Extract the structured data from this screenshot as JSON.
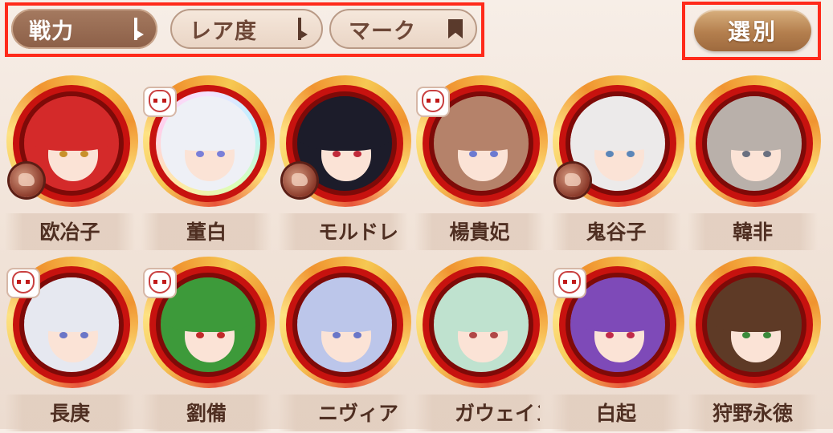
{
  "toolbar": {
    "sort_power": "戦力",
    "sort_rarity": "レア度",
    "sort_mark": "マーク",
    "select": "選別"
  },
  "colors": {
    "highlight_box": "#ff2a1a",
    "active_pill": "#8c5f47",
    "select_button": "#b47f4e",
    "frame_red": "#c7120f"
  },
  "characters": [
    {
      "name": "欧冶子",
      "hair": "#d42a2a",
      "eyes": "#c8902a",
      "fox_mask": false,
      "fist_badge": true,
      "rainbow": false
    },
    {
      "name": "董白",
      "hair": "#eef0f6",
      "eyes": "#7a7fd8",
      "fox_mask": true,
      "fist_badge": false,
      "rainbow": true
    },
    {
      "name": "モルドレ",
      "hair": "#1c1c2a",
      "eyes": "#c02a3a",
      "fox_mask": false,
      "fist_badge": true,
      "rainbow": false
    },
    {
      "name": "楊貴妃",
      "hair": "#b5826a",
      "eyes": "#6c7ad0",
      "fox_mask": true,
      "fist_badge": false,
      "rainbow": false
    },
    {
      "name": "鬼谷子",
      "hair": "#eceaea",
      "eyes": "#5c86b8",
      "fox_mask": false,
      "fist_badge": true,
      "rainbow": false
    },
    {
      "name": "韓非",
      "hair": "#b9b0aa",
      "eyes": "#6a7080",
      "fox_mask": false,
      "fist_badge": false,
      "rainbow": false
    },
    {
      "name": "長庚",
      "hair": "#e6e8f0",
      "eyes": "#6a76c8",
      "fox_mask": true,
      "fist_badge": false,
      "rainbow": false
    },
    {
      "name": "劉備",
      "hair": "#3d9a3a",
      "eyes": "#c02a2a",
      "fox_mask": true,
      "fist_badge": false,
      "rainbow": false
    },
    {
      "name": "ニヴィア",
      "hair": "#bcc6ea",
      "eyes": "#6a76c8",
      "fox_mask": false,
      "fist_badge": false,
      "rainbow": false
    },
    {
      "name": "ガウェイン",
      "hair": "#bfe2cf",
      "eyes": "#b04848",
      "fox_mask": false,
      "fist_badge": false,
      "rainbow": false
    },
    {
      "name": "白起",
      "hair": "#7e4ab8",
      "eyes": "#c02a4a",
      "fox_mask": true,
      "fist_badge": false,
      "rainbow": false
    },
    {
      "name": "狩野永徳",
      "hair": "#5e3a26",
      "eyes": "#3a8a3a",
      "fox_mask": false,
      "fist_badge": false,
      "rainbow": false
    }
  ]
}
